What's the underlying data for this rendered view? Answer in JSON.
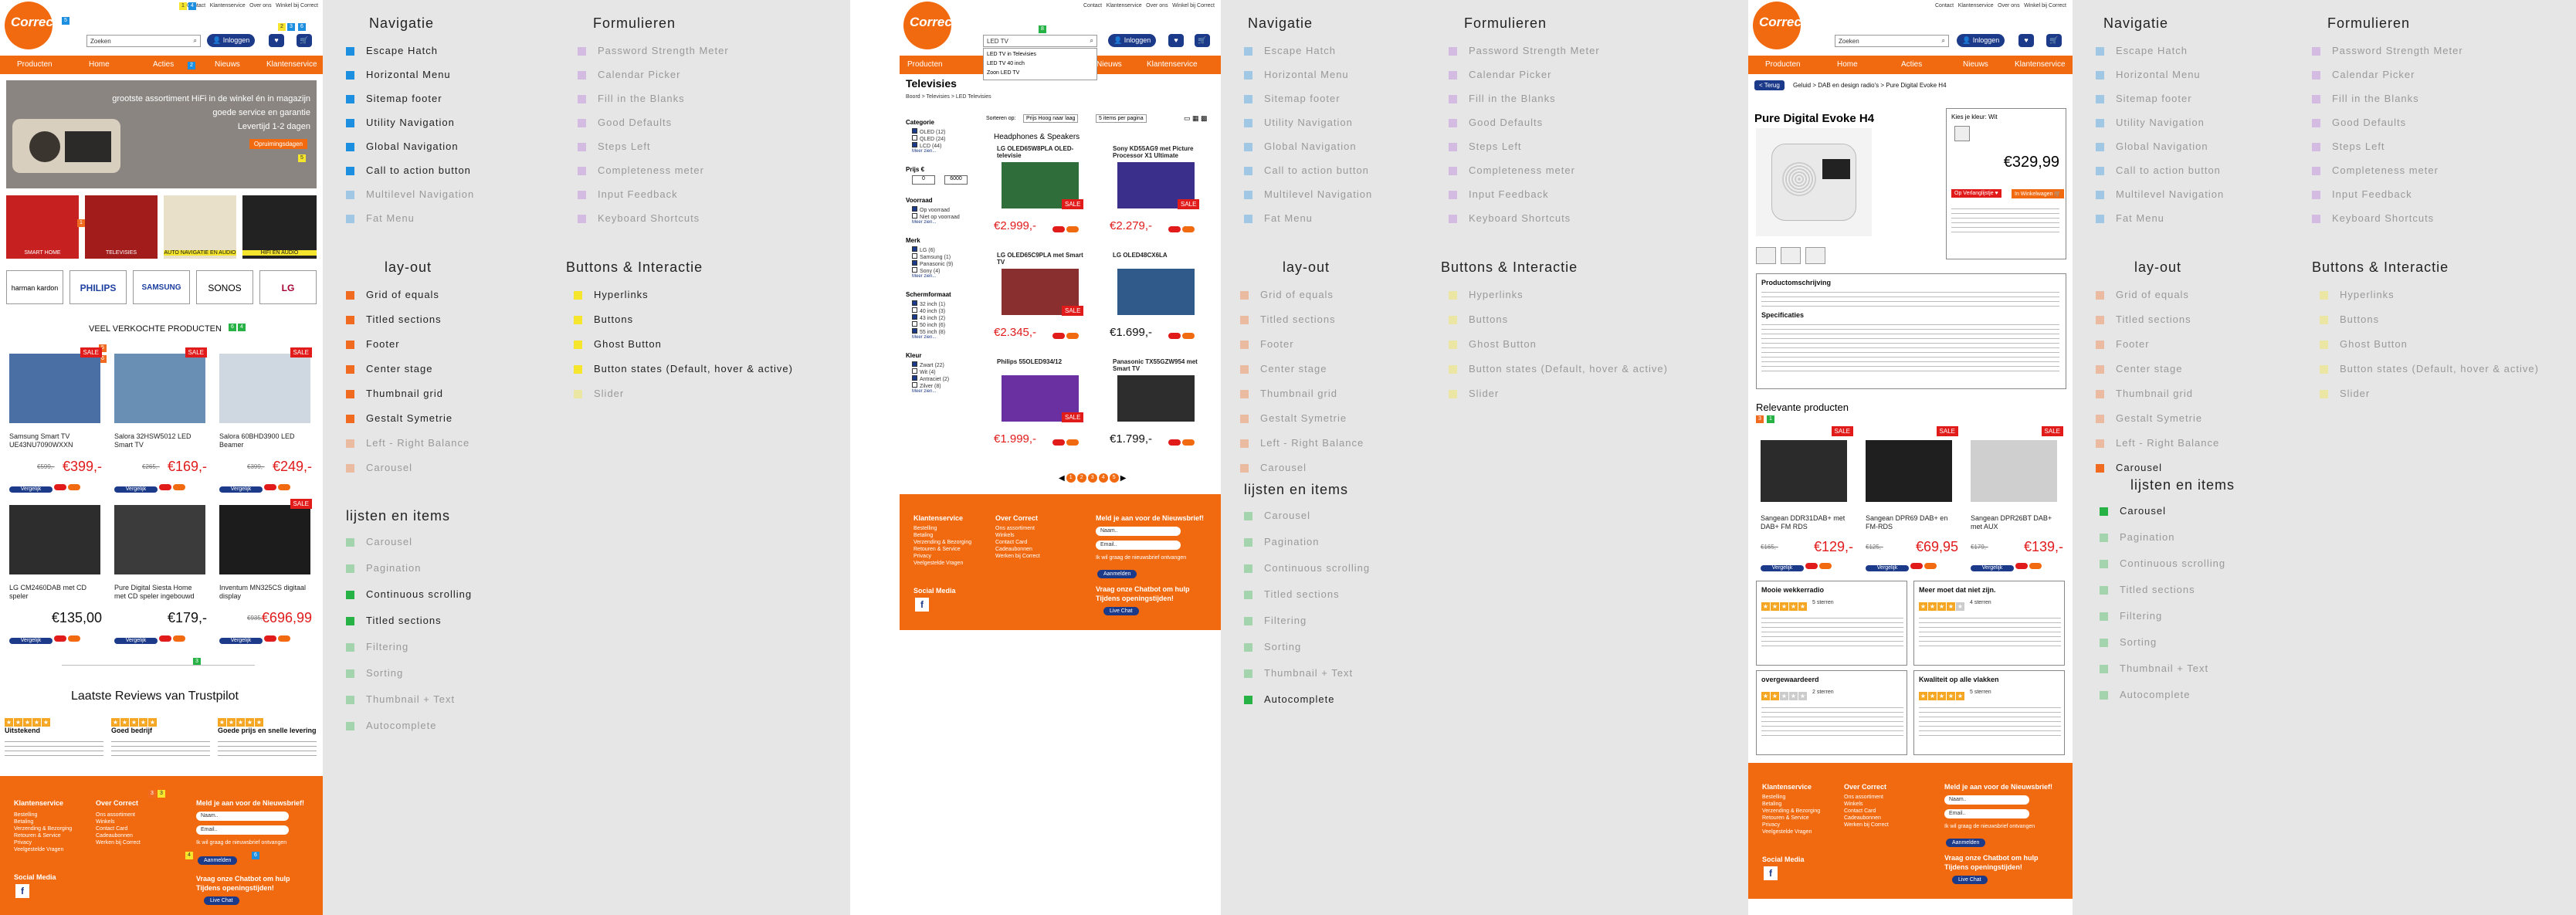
{
  "colors": {
    "brand": "#f26a10",
    "navy": "#1c3a8a",
    "sale": "#e11a1a",
    "legend_blue": "#1d8fe1",
    "legend_purple": "#b36ad8",
    "legend_orange": "#f06a20",
    "legend_yellow": "#f5e52c",
    "legend_green": "#27b245"
  },
  "header": {
    "logo": "Correct",
    "util": [
      "Contact",
      "Klantenservice",
      "Over ons",
      "Winkel bij Correct"
    ],
    "search_placeholder": "Zoeken",
    "search_value_p2": "LED TV",
    "login": "Inloggen",
    "nav": [
      "Producten",
      "Home",
      "Acties",
      "Nieuws",
      "Klantenservice"
    ]
  },
  "p1": {
    "hero": [
      "grootste assortiment HiFi in de winkel én in magazijn",
      "goede service en garantie",
      "Levertijd 1-2 dagen"
    ],
    "hero_tag": "Opruimingsdagen",
    "tiles": [
      "SMART HOME",
      "TELEVISIES",
      "AUTO NAVIGATIE EN AUDIO",
      "HIFI EN AUDIO"
    ],
    "brands": [
      "harman kardon",
      "PHILIPS",
      "SAMSUNG",
      "SONOS",
      "LG"
    ],
    "section": "VEEL VERKOCHTE  PRODUCTEN",
    "products": [
      {
        "name": "Samsung Smart TV UE43NU7090WXXN",
        "old": "€599,-",
        "price": "€399,-",
        "sale": true
      },
      {
        "name": "Salora 32HSW5012 LED Smart TV",
        "old": "€265,-",
        "price": "€169,-",
        "sale": true
      },
      {
        "name": "Salora 60BHD3900 LED Beamer",
        "old": "€399,-",
        "price": "€249,-",
        "sale": true
      },
      {
        "name": "LG CM2460DAB met CD speler",
        "old": "",
        "price": "€135,00",
        "sale": false
      },
      {
        "name": "Pure Digital Siesta Home met CD speler ingebouwd",
        "old": "",
        "price": "€179,-",
        "sale": false
      },
      {
        "name": "Inventum MN325CS digitaal display",
        "old": "€935,-",
        "price": "€696,99",
        "sale": true
      }
    ],
    "sale_label": "SALE",
    "compare": "Vergelijk",
    "reviews_title": "Laatste Reviews van Trustpilot",
    "reviews": [
      {
        "head": "Uitstekend",
        "sub": "Goed bedrijf",
        "t": "Goede prijs en snelle levering"
      }
    ],
    "review_heads": [
      "Uitstekend",
      "Goed bedrijf",
      "Goede prijs en snelle levering"
    ]
  },
  "footer": {
    "col1_title": "Klantenservice",
    "col1": [
      "Bestelling",
      "Betaling",
      "Verzending & Bezorging",
      "Retouren & Service",
      "Privacy",
      "Veelgestelde Vragen"
    ],
    "col2_title": "Over Correct",
    "col2": [
      "Ons assortiment",
      "Winkels",
      "Contact Card",
      "Cadeaubonnen",
      "Werken bij Correct"
    ],
    "news_title": "Meld je aan voor de Nieuwsbrief!",
    "name_ph": "Naam..",
    "email_ph": "Email..",
    "consent": "Ik wil graag de nieuwsbrief ontvangen",
    "subscribe": "Aanmelden",
    "social": "Social Media",
    "chat_title": "Vraag onze Chatbot om hulp",
    "chat_hours": "Tijdens openingstijden!",
    "chat_btn": "Live Chat"
  },
  "legend": {
    "nav_title": "Navigatie",
    "nav": [
      "Escape Hatch",
      "Horizontal Menu",
      "Sitemap footer",
      "Utility Navigation",
      "Global Navigation",
      "Call to action button",
      "Multilevel Navigation",
      "Fat Menu"
    ],
    "form_title": "Formulieren",
    "form": [
      "Password Strength Meter",
      "Calendar Picker",
      "Fill in the Blanks",
      "Good Defaults",
      "Steps Left",
      "Completeness meter",
      "Input Feedback",
      "Keyboard Shortcuts"
    ],
    "layout_title": "lay-out",
    "layout": [
      "Grid of equals",
      "Titled sections",
      "Footer",
      "Center stage",
      "Thumbnail grid",
      "Gestalt Symetrie",
      "Left - Right Balance",
      "Carousel"
    ],
    "btn_title": "Buttons & Interactie",
    "btn": [
      "Hyperlinks",
      "Buttons",
      "Ghost Button",
      "Button states (Default, hover & active)",
      "Slider"
    ],
    "list_title": "lijsten en items",
    "list": [
      "Carousel",
      "Pagination",
      "Continuous scrolling",
      "Titled sections",
      "Filtering",
      "Sorting",
      "Thumbnail + Text",
      "Autocomplete"
    ]
  },
  "p2": {
    "autocomplete": [
      "LED TV in Televisies",
      "LED TV 40 inch",
      "Zoon LED TV"
    ],
    "title": "Televisies",
    "breadcrumb": "Boord > Televisies > LED Televisies",
    "sort_label": "Sorteren op:",
    "sort_value": "Prijs Hoog naar laag",
    "per_page": "5 items per pagina",
    "filters": [
      {
        "t": "Categorie",
        "o": [
          "OLED (12)",
          "QLED (24)",
          "LCD (44)"
        ]
      },
      {
        "t": "Prijs €",
        "o": [
          "0",
          "6000"
        ]
      },
      {
        "t": "Voorraad",
        "o": [
          "Op voorraad",
          "Niet op voorraad"
        ]
      },
      {
        "t": "Merk",
        "o": [
          "LG (6)",
          "Samsung (1)",
          "Panasonic (9)",
          "Sony (4)"
        ]
      },
      {
        "t": "Schermformaat",
        "o": [
          "32 inch (1)",
          "40 inch (3)",
          "43 inch (2)",
          "50 inch (6)",
          "55 inch (8)"
        ]
      },
      {
        "t": "Kleur",
        "o": [
          "Zwart (22)",
          "Wit (4)",
          "Antraciet (2)",
          "Zilver (8)"
        ]
      }
    ],
    "more": "Meer zien...",
    "group": "Headphones & Speakers",
    "products": [
      {
        "name": "LG OLED65W8PLA OLED-televisie",
        "price": "€2.999,-",
        "sale": true
      },
      {
        "name": "Sony KD55AG9 met Picture Processor X1 Ultimate",
        "price": "€2.279,-",
        "sale": true
      },
      {
        "name": "LG OLED65C9PLA met Smart TV",
        "price": "€2.345,-",
        "sale": true
      },
      {
        "name": "LG OLED48CX6LA",
        "price": "€1.699,-",
        "sale": false
      },
      {
        "name": "Philips 55OLED934/12",
        "price": "€1.999,-",
        "sale": true
      },
      {
        "name": "Panasonic TX55GZW954 met Smart TV",
        "price": "€1.799,-",
        "sale": false
      }
    ],
    "pages": [
      "1",
      "2",
      "3",
      "4",
      "5"
    ]
  },
  "p3": {
    "back": "< Terug",
    "crumb": "Geluid > DAB en design radio's > Pure Digital Evoke H4",
    "title": "Pure Digital Evoke H4",
    "color_label": "Kies je kleur:",
    "color_value": "Wit",
    "price": "€329,99",
    "wish": "Op Verlanglijstje",
    "cart": "In Winkelwagen",
    "desc_title": "Productomschrijving",
    "spec_title": "Specificaties",
    "related": "Relevante producten",
    "rel": [
      {
        "name": "Sangean DDR31DAB+ met DAB+ FM RDS",
        "old": "€165,-",
        "price": "€129,-"
      },
      {
        "name": "Sangean DPR69 DAB+ en FM-RDS",
        "old": "€125,-",
        "price": "€69,95"
      },
      {
        "name": "Sangean DPR26BT DAB+ met AUX",
        "old": "€179,-",
        "price": "€139,-"
      }
    ],
    "reviews": [
      {
        "t": "Mooie wekkerradio",
        "stars": "5 sterren"
      },
      {
        "t": "Meer moet dat niet zijn.",
        "stars": "4 sterren"
      },
      {
        "t": "overgewaardeerd",
        "stars": "2 sterren"
      },
      {
        "t": "Kwaliteit op alle vlakken",
        "stars": "5 sterren"
      }
    ]
  }
}
